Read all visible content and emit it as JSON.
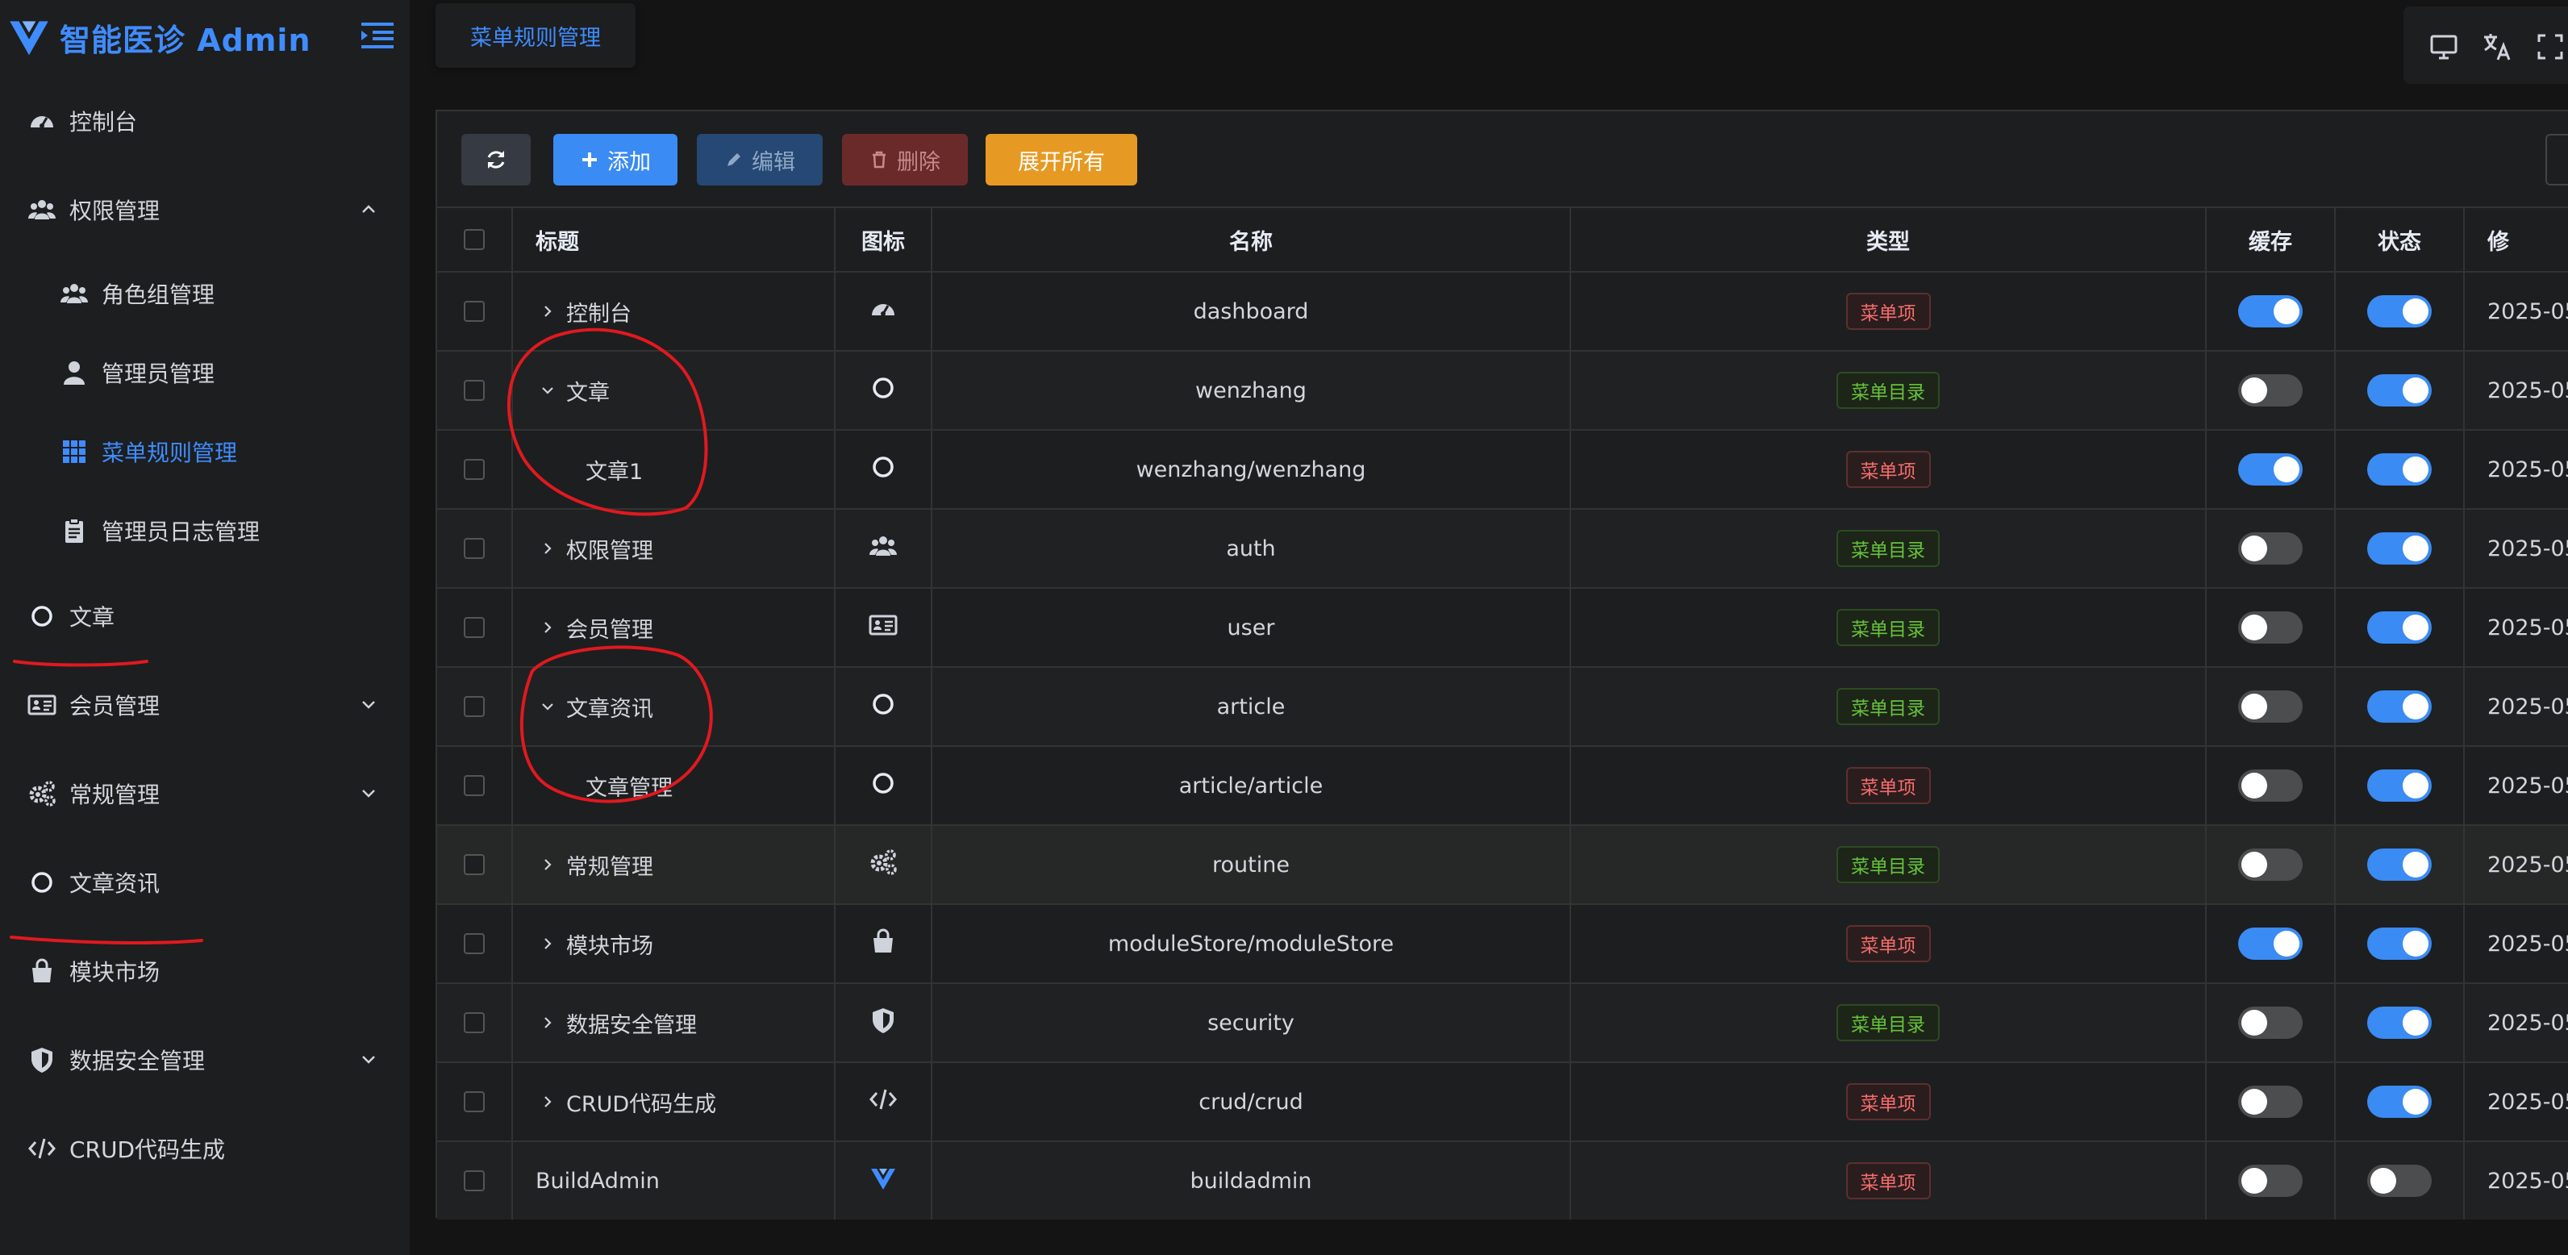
{
  "app": {
    "title": "智能医诊 Admin",
    "brand_color": "#3f8cff"
  },
  "sidebar": {
    "items": [
      {
        "label": "控制台",
        "icon": "dashboard-icon"
      },
      {
        "label": "权限管理",
        "icon": "users-icon",
        "expanded": true
      },
      {
        "label": "角色组管理",
        "icon": "users-icon"
      },
      {
        "label": "管理员管理",
        "icon": "user-icon"
      },
      {
        "label": "菜单规则管理",
        "icon": "grid-icon",
        "active": true
      },
      {
        "label": "管理员日志管理",
        "icon": "clipboard-icon"
      },
      {
        "label": "文章",
        "icon": "circle-icon"
      },
      {
        "label": "会员管理",
        "icon": "id-card-icon",
        "expanded": false
      },
      {
        "label": "常规管理",
        "icon": "gears-icon",
        "expanded": false
      },
      {
        "label": "文章资讯",
        "icon": "circle-icon"
      },
      {
        "label": "模块市场",
        "icon": "shopping-bag-icon"
      },
      {
        "label": "数据安全管理",
        "icon": "shield-icon",
        "expanded": false
      },
      {
        "label": "CRUD代码生成",
        "icon": "code-icon"
      }
    ]
  },
  "header": {
    "tab": "菜单规则管理"
  },
  "toolbar": {
    "add": "添加",
    "edit": "编辑",
    "delete": "删除",
    "expand_all": "展开所有"
  },
  "table": {
    "headers": {
      "title": "标题",
      "icon": "图标",
      "name": "名称",
      "type": "类型",
      "cache": "缓存",
      "status": "状态",
      "updated": "修"
    },
    "rows": [
      {
        "title": "控制台",
        "arrow": "right",
        "icon": "dashboard-icon",
        "name": "dashboard",
        "type": "菜单项",
        "type_kind": "item",
        "cache": true,
        "status": true,
        "updated": "2025-05"
      },
      {
        "title": "文章",
        "arrow": "down",
        "icon": "circle-icon",
        "name": "wenzhang",
        "type": "菜单目录",
        "type_kind": "dir",
        "cache": false,
        "status": true,
        "updated": "2025-05"
      },
      {
        "title": "文章1",
        "arrow": "none",
        "child": true,
        "icon": "circle-icon",
        "name": "wenzhang/wenzhang",
        "type": "菜单项",
        "type_kind": "item",
        "cache": true,
        "status": true,
        "updated": "2025-05"
      },
      {
        "title": "权限管理",
        "arrow": "right",
        "icon": "users-icon",
        "name": "auth",
        "type": "菜单目录",
        "type_kind": "dir",
        "cache": false,
        "status": true,
        "updated": "2025-05"
      },
      {
        "title": "会员管理",
        "arrow": "right",
        "icon": "id-card-icon",
        "name": "user",
        "type": "菜单目录",
        "type_kind": "dir",
        "cache": false,
        "status": true,
        "updated": "2025-05"
      },
      {
        "title": "文章资讯",
        "arrow": "down",
        "icon": "circle-icon",
        "name": "article",
        "type": "菜单目录",
        "type_kind": "dir",
        "cache": false,
        "status": true,
        "updated": "2025-05"
      },
      {
        "title": "文章管理",
        "arrow": "none",
        "child": true,
        "icon": "circle-icon",
        "name": "article/article",
        "type": "菜单项",
        "type_kind": "item",
        "cache": false,
        "status": true,
        "updated": "2025-05"
      },
      {
        "title": "常规管理",
        "arrow": "right",
        "icon": "gears-icon",
        "name": "routine",
        "type": "菜单目录",
        "type_kind": "dir",
        "cache": false,
        "status": true,
        "updated": "2025-05"
      },
      {
        "title": "模块市场",
        "arrow": "right",
        "icon": "shopping-bag-icon",
        "name": "moduleStore/moduleStore",
        "type": "菜单项",
        "type_kind": "item",
        "cache": true,
        "status": true,
        "updated": "2025-05"
      },
      {
        "title": "数据安全管理",
        "arrow": "right",
        "icon": "shield-icon",
        "name": "security",
        "type": "菜单目录",
        "type_kind": "dir",
        "cache": false,
        "status": true,
        "updated": "2025-05"
      },
      {
        "title": "CRUD代码生成",
        "arrow": "right",
        "icon": "code-icon",
        "name": "crud/crud",
        "type": "菜单项",
        "type_kind": "item",
        "cache": false,
        "status": true,
        "updated": "2025-05"
      },
      {
        "title": "BuildAdmin",
        "arrow": "none",
        "icon": "buildadmin-logo-icon",
        "name": "buildadmin",
        "type": "菜单项",
        "type_kind": "item",
        "cache": false,
        "status": false,
        "updated": "2025-05"
      }
    ]
  }
}
